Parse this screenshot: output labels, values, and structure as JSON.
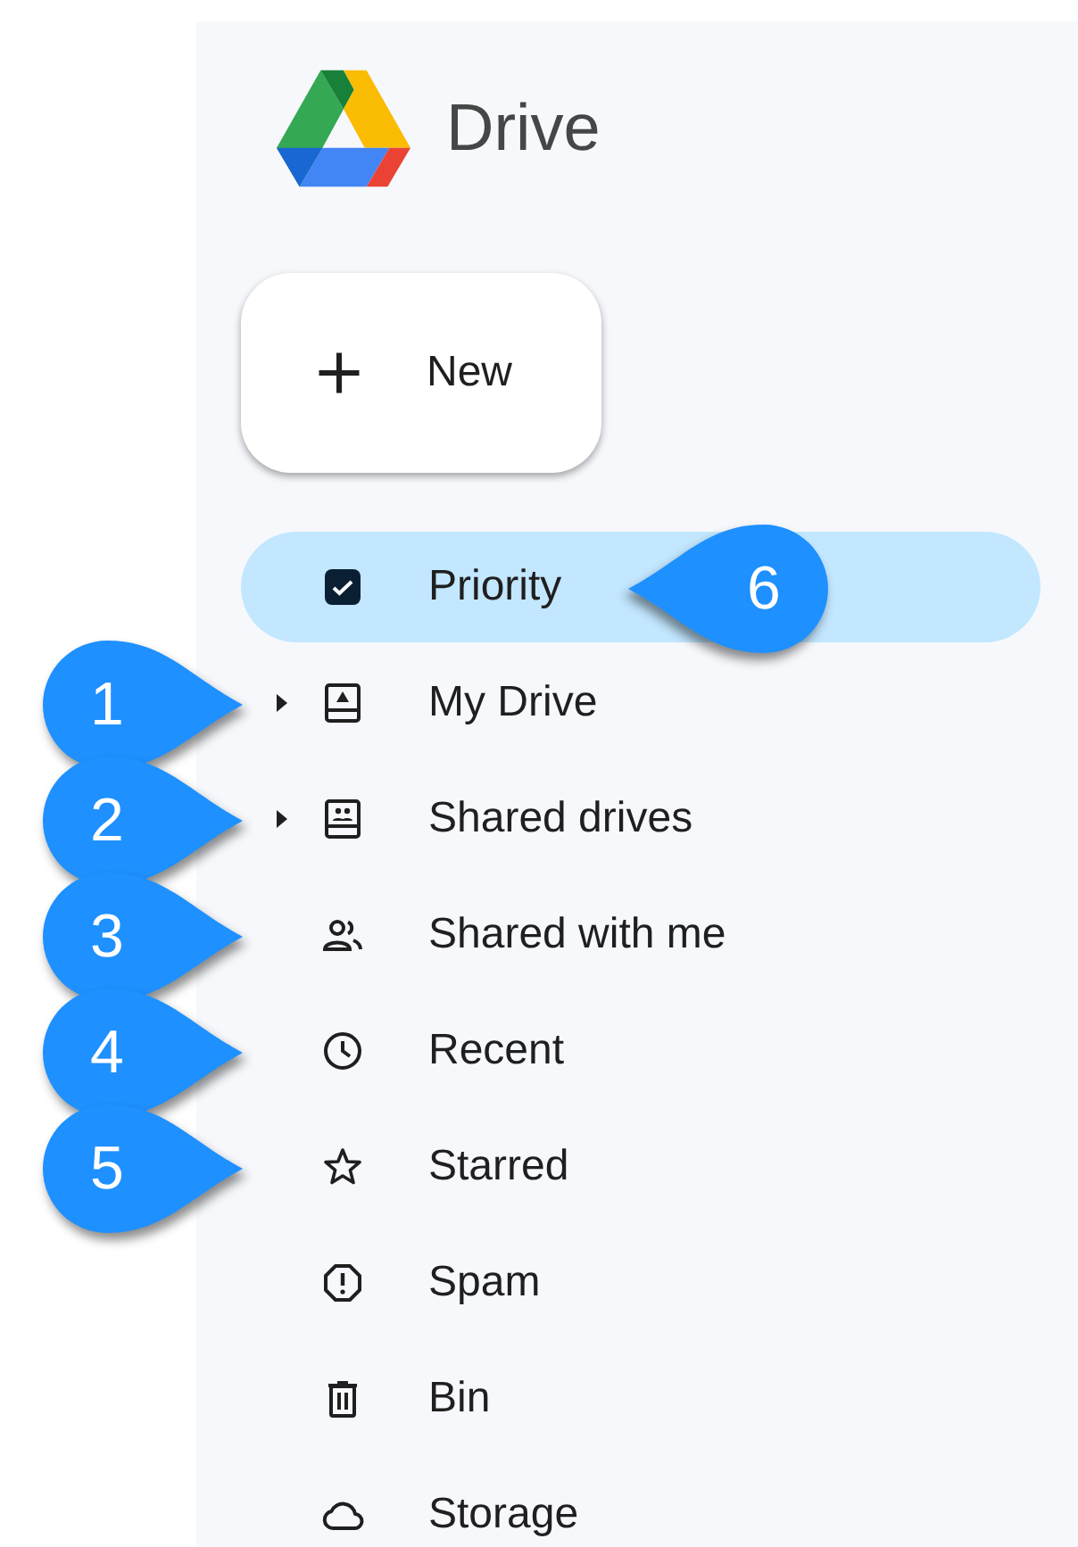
{
  "app": {
    "name": "Drive"
  },
  "new_button": {
    "label": "New"
  },
  "nav": [
    {
      "kind": "priority",
      "label": "Priority",
      "selected": true,
      "expandable": false,
      "callout": {
        "label": "6",
        "kind": "tip-left"
      }
    },
    {
      "kind": "my-drive",
      "label": "My Drive",
      "selected": false,
      "expandable": true,
      "callout": {
        "label": "1",
        "kind": "tip-right"
      }
    },
    {
      "kind": "shared-drives",
      "label": "Shared drives",
      "selected": false,
      "expandable": true,
      "callout": {
        "label": "2",
        "kind": "tip-right"
      }
    },
    {
      "kind": "shared",
      "label": "Shared with me",
      "selected": false,
      "expandable": false,
      "callout": {
        "label": "3",
        "kind": "tip-right"
      }
    },
    {
      "kind": "recent",
      "label": "Recent",
      "selected": false,
      "expandable": false,
      "callout": {
        "label": "4",
        "kind": "tip-right"
      }
    },
    {
      "kind": "starred",
      "label": "Starred",
      "selected": false,
      "expandable": false,
      "callout": {
        "label": "5",
        "kind": "tip-right"
      }
    },
    {
      "kind": "spam",
      "label": "Spam",
      "selected": false,
      "expandable": false
    },
    {
      "kind": "bin",
      "label": "Bin",
      "selected": false,
      "expandable": false
    },
    {
      "kind": "storage",
      "label": "Storage",
      "selected": false,
      "expandable": false
    }
  ]
}
